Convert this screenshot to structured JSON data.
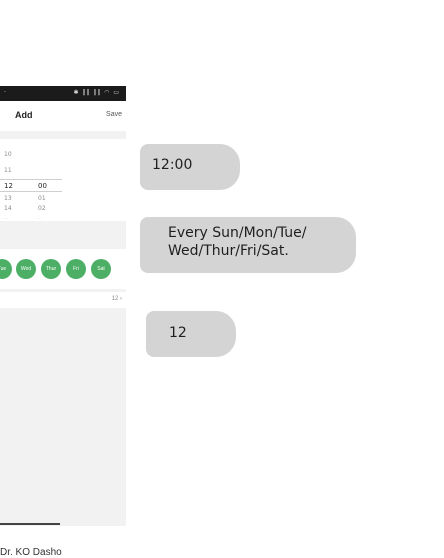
{
  "status_bar": {
    "icons_text": "✱ ‖‖ ‖‖ ◠ ▭"
  },
  "header": {
    "title": "Add",
    "save_label": "Save"
  },
  "time_picker": {
    "hours": [
      "",
      "10",
      "11",
      "12",
      "13",
      "14",
      "..."
    ],
    "minutes": [
      "00",
      "01",
      "02",
      "..."
    ],
    "selected_hour": "12",
    "selected_minute": "00"
  },
  "repeat_days": [
    "Tue",
    "Wed",
    "Thur",
    "Fri",
    "Sat"
  ],
  "repeat_count": {
    "value": "12",
    "chevron": "›"
  },
  "caption": "Dr. KO Dasho",
  "annotations": {
    "time": "12:00",
    "repeat": "Every Sun/Mon/Tue/ Wed/Thur/Fri/Sat.",
    "count": "12"
  },
  "colors": {
    "day_chip": "#4caf65",
    "bubble": "#d4d4d4",
    "status_bar": "#1b1b1b"
  }
}
